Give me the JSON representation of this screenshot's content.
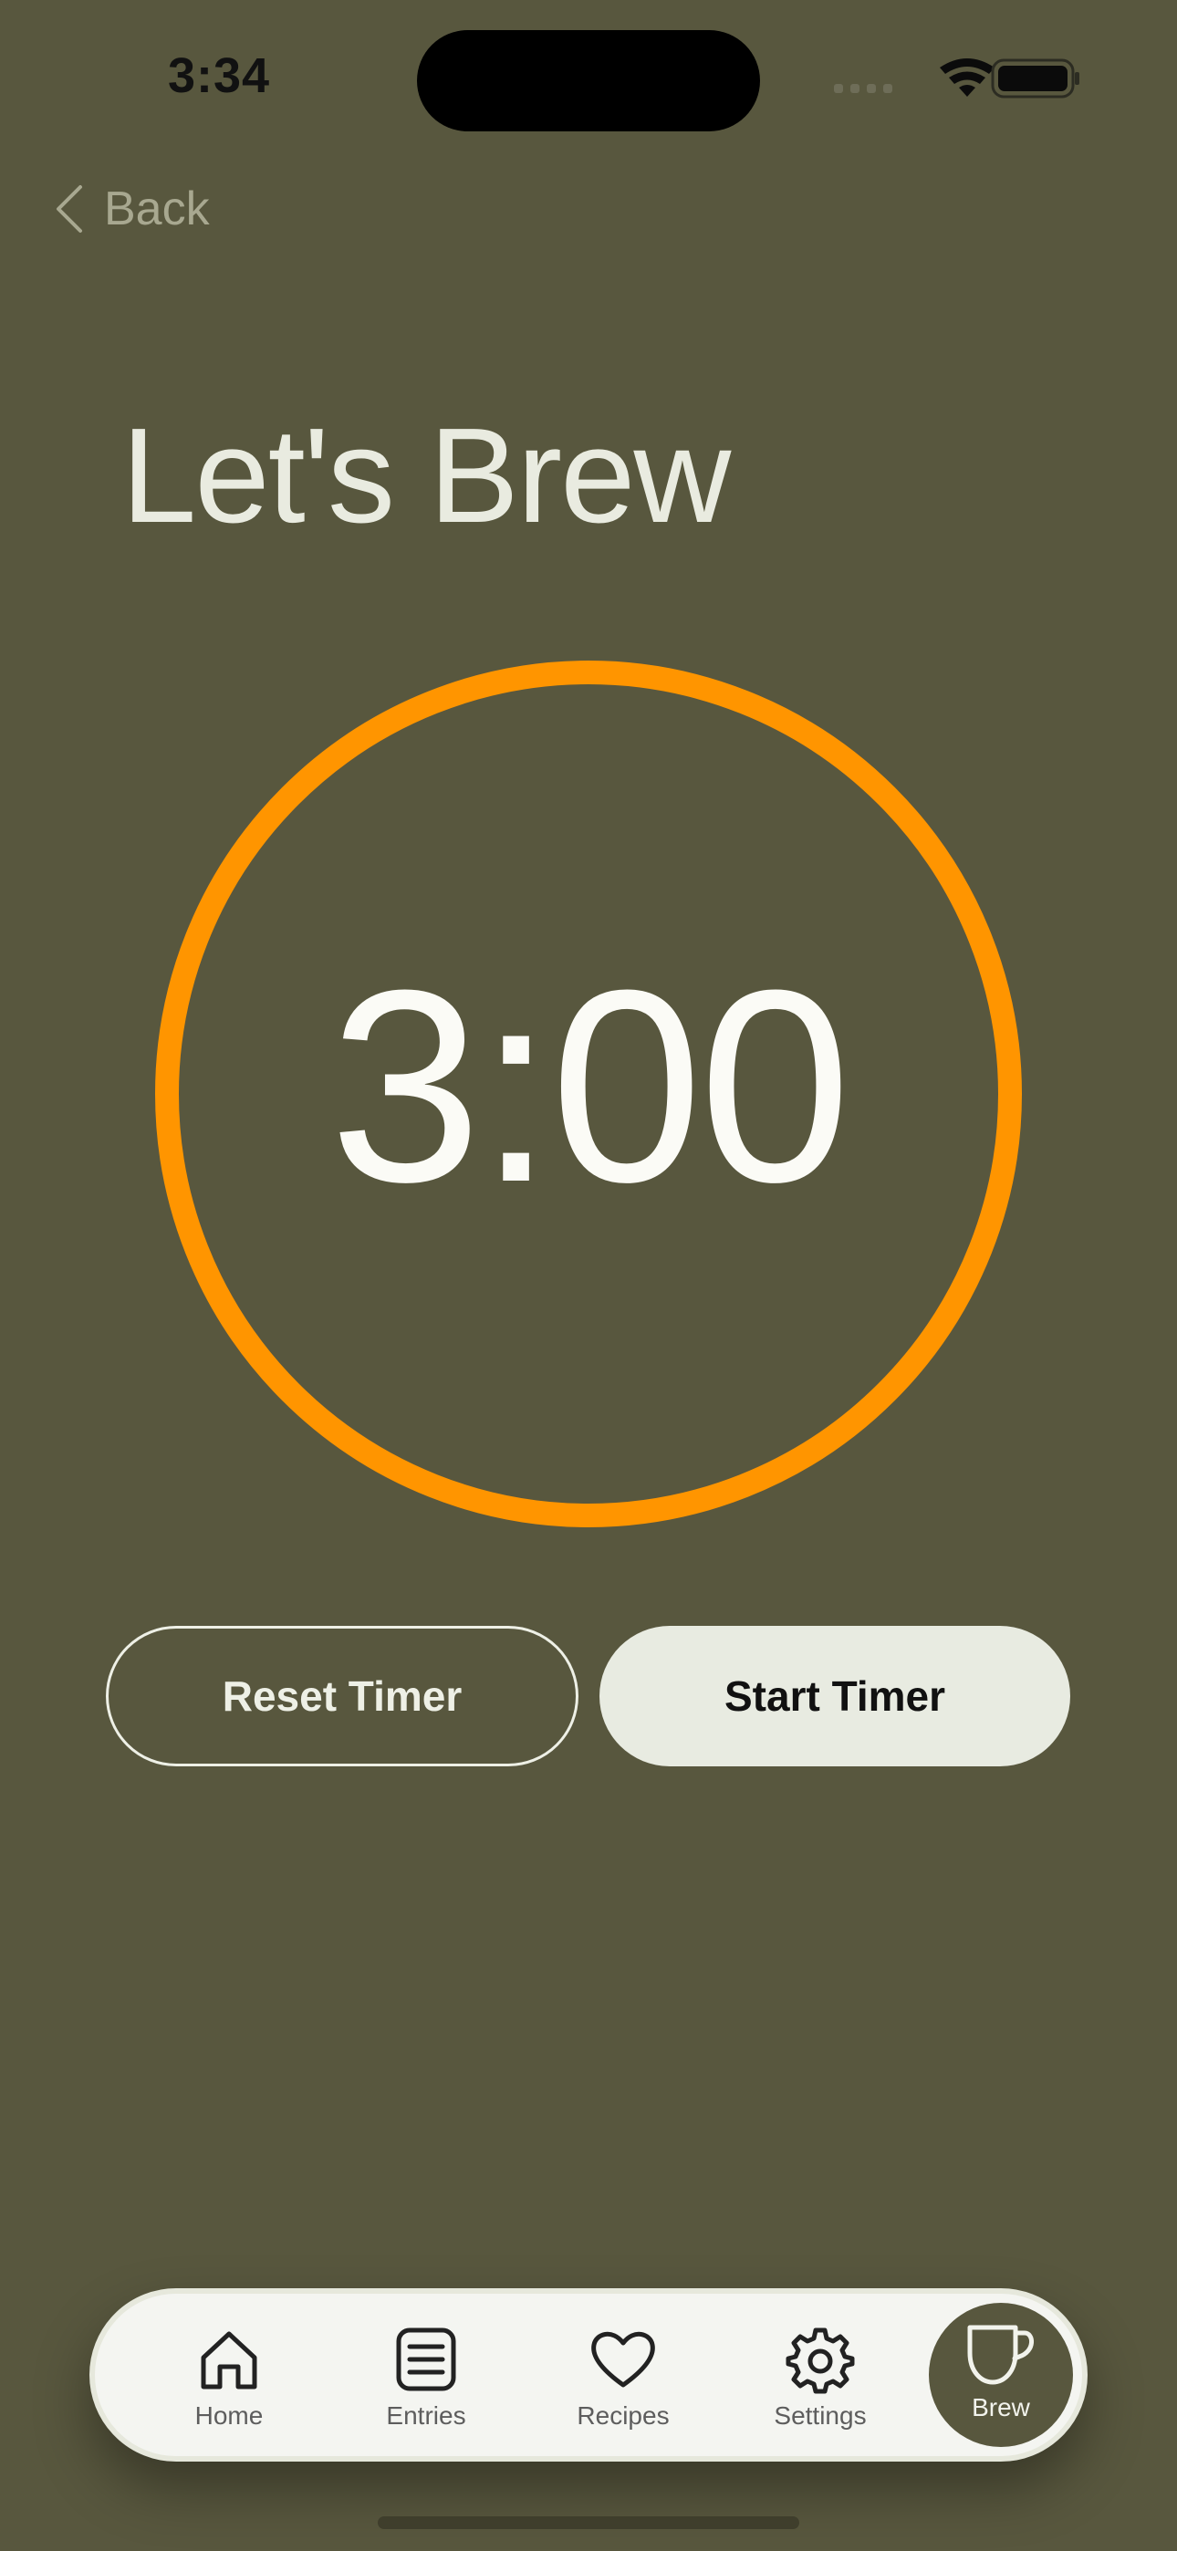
{
  "status_bar": {
    "time": "3:34"
  },
  "nav": {
    "back_label": "Back"
  },
  "page": {
    "title": "Let's Brew"
  },
  "timer": {
    "display": "3:00",
    "ring_color": "#ff9500"
  },
  "buttons": {
    "reset_label": "Reset Timer",
    "start_label": "Start Timer"
  },
  "tabbar": {
    "items": [
      {
        "label": "Home",
        "icon": "house-icon"
      },
      {
        "label": "Entries",
        "icon": "list-icon"
      },
      {
        "label": "Recipes",
        "icon": "heart-icon"
      },
      {
        "label": "Settings",
        "icon": "gear-icon"
      },
      {
        "label": "Brew",
        "icon": "cup-icon",
        "selected": true
      }
    ]
  },
  "colors": {
    "background": "#58573e",
    "accent": "#ff9500",
    "text_light": "#e9ebe0"
  }
}
